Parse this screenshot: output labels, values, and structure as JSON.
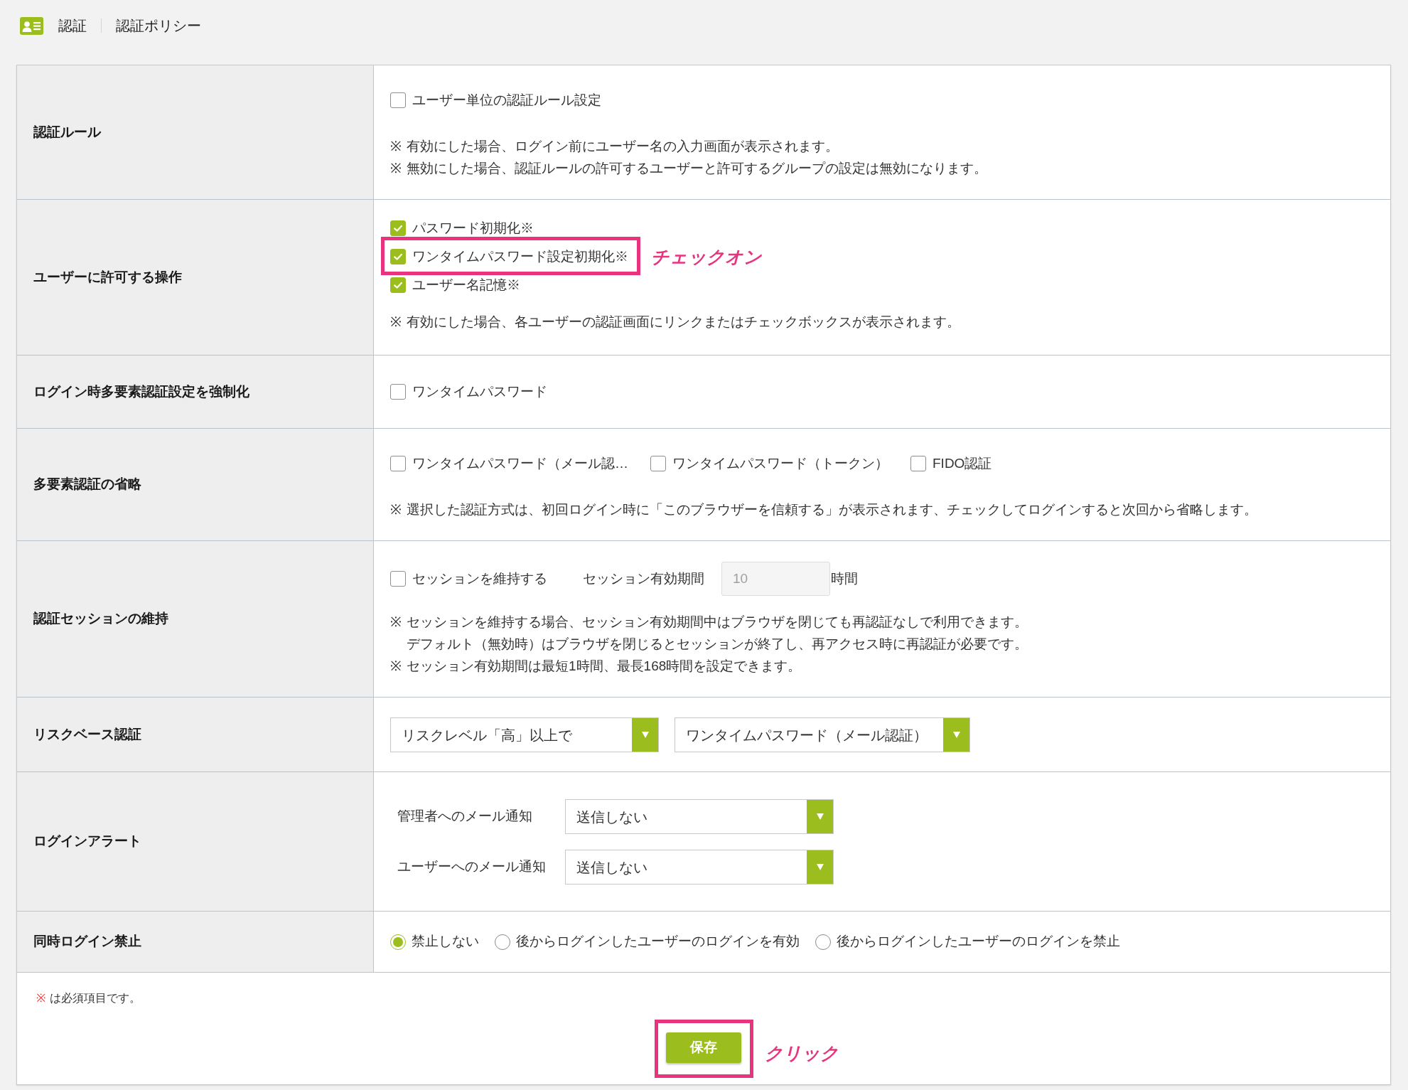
{
  "breadcrumb": [
    "認証",
    "認証ポリシー"
  ],
  "rows": [
    {
      "label": "認証ルール",
      "kind": "checkbox_stack",
      "options": [
        {
          "label": "ユーザー単位の認証ルール設定",
          "checked": false
        }
      ],
      "notes": [
        {
          "mark": "※",
          "lines": [
            "有効にした場合、ログイン前にユーザー名の入力画面が表示されます。"
          ]
        },
        {
          "mark": "※",
          "lines": [
            "無効にした場合、認証ルールの許可するユーザーと許可するグループの設定は無効になります。"
          ]
        }
      ]
    },
    {
      "label": "ユーザーに許可する操作",
      "kind": "checkbox_stack",
      "options": [
        {
          "label": "パスワード初期化※",
          "checked": true,
          "highlighted": false
        },
        {
          "label": "ワンタイムパスワード設定初期化※",
          "checked": true,
          "highlighted": true,
          "callout": "チェックオン"
        },
        {
          "label": "ユーザー名記憶※",
          "checked": true,
          "highlighted": false
        }
      ],
      "notes": [
        {
          "mark": "※",
          "lines": [
            "有効にした場合、各ユーザーの認証画面にリンクまたはチェックボックスが表示されます。"
          ]
        }
      ]
    },
    {
      "label": "ログイン時多要素認証設定を強制化",
      "kind": "checkbox_stack",
      "options": [
        {
          "label": "ワンタイムパスワード",
          "checked": false
        }
      ]
    },
    {
      "label": "多要素認証の省略",
      "kind": "checkbox_row",
      "options": [
        {
          "label": "ワンタイムパスワード（メール認…",
          "checked": false
        },
        {
          "label": "ワンタイムパスワード（トークン）",
          "checked": false
        },
        {
          "label": "FIDO認証",
          "checked": false
        }
      ],
      "notes": [
        {
          "mark": "※",
          "lines": [
            "選択した認証方式は、初回ログイン時に「このブラウザーを信頼する」が表示されます、チェックしてログインすると次回から省略します。"
          ]
        }
      ]
    },
    {
      "label": "認証セッションの維持",
      "kind": "session",
      "options": [
        {
          "label": "セッションを維持する",
          "checked": false
        }
      ],
      "field_label": "セッション有効期間",
      "field": {
        "value": "10",
        "disabled": true
      },
      "unit": "時間",
      "notes": [
        {
          "mark": "※",
          "lines": [
            "セッションを維持する場合、セッション有効期間中はブラウザを閉じても再認証なしで利用できます。",
            "デフォルト（無効時）はブラウザを閉じるとセッションが終了し、再アクセス時に再認証が必要です。"
          ]
        },
        {
          "mark": "※",
          "lines": [
            "セッション有効期間は最短1時間、最長168時間を設定できます。"
          ]
        }
      ]
    },
    {
      "label": "リスクベース認証",
      "kind": "select_row",
      "selects": [
        {
          "value": "リスクレベル「高」以上で"
        },
        {
          "value": "ワンタイムパスワード（メール認証）"
        }
      ]
    },
    {
      "label": "ログインアラート",
      "kind": "labeled_selects",
      "selects": [
        {
          "label": "管理者へのメール通知",
          "value": "送信しない"
        },
        {
          "label": "ユーザーへのメール通知",
          "value": "送信しない"
        }
      ]
    },
    {
      "label": "同時ログイン禁止",
      "kind": "radio_row",
      "options": [
        {
          "label": "禁止しない",
          "selected": true
        },
        {
          "label": "後からログインしたユーザーのログインを有効",
          "selected": false
        },
        {
          "label": "後からログインしたユーザーのログインを禁止",
          "selected": false
        }
      ]
    }
  ],
  "footer": {
    "required_mark": "※",
    "required_text": "は必須項目です。",
    "save_button": {
      "label": "保存",
      "highlighted": true,
      "callout": "クリック"
    }
  }
}
